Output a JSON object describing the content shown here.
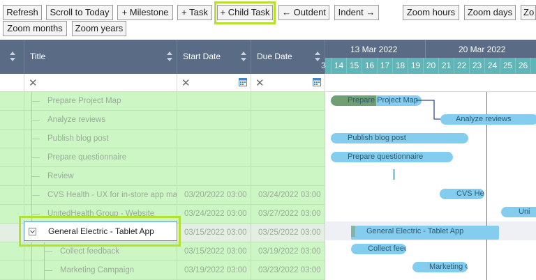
{
  "toolbar": {
    "refresh": "Refresh",
    "scroll_today": "Scroll to Today",
    "milestone": "+ Milestone",
    "task": "+ Task",
    "child_task": "+ Child Task",
    "outdent": "← Outdent",
    "indent": "Indent →",
    "zoom_hours": "Zoom hours",
    "zoom_days": "Zoom days",
    "zoom_weeks_partial": "Zo",
    "zoom_months": "Zoom months",
    "zoom_years": "Zoom years"
  },
  "grid": {
    "columns": {
      "title": "Title",
      "start": "Start Date",
      "due": "Due Date"
    },
    "filter_clear": "✕",
    "rows": [
      {
        "title": "Prepare Project Map",
        "start": "",
        "due": ""
      },
      {
        "title": "Analyze reviews",
        "start": "",
        "due": ""
      },
      {
        "title": "Publish blog post",
        "start": "",
        "due": ""
      },
      {
        "title": "Prepare questionnaire",
        "start": "",
        "due": ""
      },
      {
        "title": "Review",
        "start": "",
        "due": ""
      },
      {
        "title": "CVS Health - UX for in-store app map",
        "start": "03/20/2022 03:00",
        "due": "03/24/2022 03:00"
      },
      {
        "title": "UnitedHealth Group - Website",
        "start": "03/24/2022 03:00",
        "due": "03/27/2022 03:00"
      },
      {
        "title": "General Electric - Tablet App",
        "start": "03/15/2022 03:00",
        "due": "03/25/2022 03:00"
      },
      {
        "title": "Collect feedback",
        "start": "03/15/2022 03:00",
        "due": "03/19/2022 03:00"
      },
      {
        "title": "Marketing Campaign",
        "start": "03/19/2022 03:00",
        "due": "03/23/2022 03:00"
      }
    ]
  },
  "timeline": {
    "weeks": [
      "13 Mar 2022",
      "20 Mar 2022"
    ],
    "days": [
      "3",
      "14",
      "15",
      "16",
      "17",
      "18",
      "19",
      "20",
      "21",
      "22",
      "23",
      "24",
      "25",
      "26"
    ],
    "bars": {
      "prepare_map": "Prepare Project Map",
      "analyze": "Analyze reviews",
      "publish": "Publish blog post",
      "questionnaire": "Prepare questionnaire",
      "cvs": "CVS Hea",
      "united": "Uni",
      "ge": "General Electric - Tablet App",
      "collect": "Collect feed",
      "marketing": "Marketing C"
    }
  },
  "colors": {
    "header_bg": "#5a6b85",
    "days_bg": "#5fb5b7",
    "row_bg": "#ccf7c4",
    "bar": "#84cdee",
    "highlight": "#b5e030",
    "today": "#cf4a4a"
  }
}
